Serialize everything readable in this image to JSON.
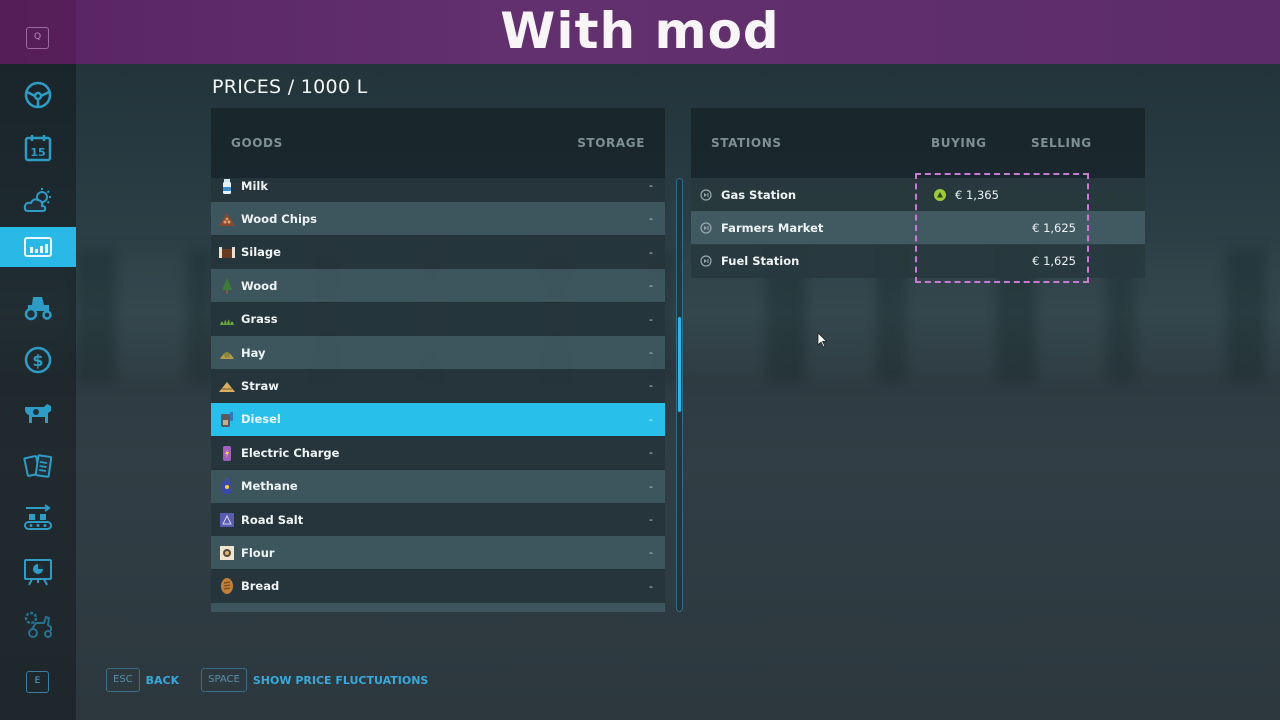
{
  "banner": {
    "title": "With mod"
  },
  "sidebar": {
    "top_key": "Q",
    "bottom_key": "E",
    "items": [
      {
        "icon": "steering-wheel-icon",
        "active": false
      },
      {
        "icon": "calendar-icon",
        "label": "15",
        "active": false
      },
      {
        "icon": "weather-icon",
        "active": false
      },
      {
        "icon": "prices-chart-icon",
        "active": true
      },
      {
        "icon": "tractor-icon",
        "active": false
      },
      {
        "icon": "finances-dollar-icon",
        "active": false
      },
      {
        "icon": "animals-cow-icon",
        "active": false
      },
      {
        "icon": "contracts-icon",
        "active": false
      },
      {
        "icon": "production-conveyor-icon",
        "active": false
      },
      {
        "icon": "statistics-board-icon",
        "active": false
      },
      {
        "icon": "garage-settings-icon",
        "active": false
      }
    ]
  },
  "page": {
    "title": "PRICES / 1000 L"
  },
  "goods": {
    "headers": {
      "goods": "GOODS",
      "storage": "STORAGE"
    },
    "rows": [
      {
        "name": "Milk",
        "storage": "-",
        "icon": "milk-icon",
        "selected": false
      },
      {
        "name": "Wood Chips",
        "storage": "-",
        "icon": "wood-chips-icon",
        "selected": false
      },
      {
        "name": "Silage",
        "storage": "-",
        "icon": "silage-icon",
        "selected": false
      },
      {
        "name": "Wood",
        "storage": "-",
        "icon": "wood-icon",
        "selected": false
      },
      {
        "name": "Grass",
        "storage": "-",
        "icon": "grass-icon",
        "selected": false
      },
      {
        "name": "Hay",
        "storage": "-",
        "icon": "hay-icon",
        "selected": false
      },
      {
        "name": "Straw",
        "storage": "-",
        "icon": "straw-icon",
        "selected": false
      },
      {
        "name": "Diesel",
        "storage": "-",
        "icon": "diesel-icon",
        "selected": true
      },
      {
        "name": "Electric Charge",
        "storage": "-",
        "icon": "electric-charge-icon",
        "selected": false
      },
      {
        "name": "Methane",
        "storage": "-",
        "icon": "methane-icon",
        "selected": false
      },
      {
        "name": "Road Salt",
        "storage": "-",
        "icon": "road-salt-icon",
        "selected": false
      },
      {
        "name": "Flour",
        "storage": "-",
        "icon": "flour-icon",
        "selected": false
      },
      {
        "name": "Bread",
        "storage": "-",
        "icon": "bread-icon",
        "selected": false
      }
    ],
    "scroll": {
      "thumb_start": 0.32,
      "thumb_end": 0.54
    }
  },
  "stations": {
    "headers": {
      "stations": "STATIONS",
      "buying": "BUYING",
      "selling": "SELLING"
    },
    "rows": [
      {
        "name": "Gas Station",
        "buying": "€ 1,365",
        "buying_trend": "up",
        "selling": ""
      },
      {
        "name": "Farmers Market",
        "buying": "",
        "selling": "€ 1,625"
      },
      {
        "name": "Fuel Station",
        "buying": "",
        "selling": "€ 1,625"
      }
    ]
  },
  "footer": {
    "actions": [
      {
        "key": "ESC",
        "label": "BACK"
      },
      {
        "key": "SPACE",
        "label": "SHOW PRICE FLUCTUATIONS"
      }
    ]
  },
  "colors": {
    "accent": "#2ab8e6",
    "banner": "#5e2a6a",
    "highlight_dashed": "#c87ad4",
    "trend_up": "#9ccc3a"
  }
}
